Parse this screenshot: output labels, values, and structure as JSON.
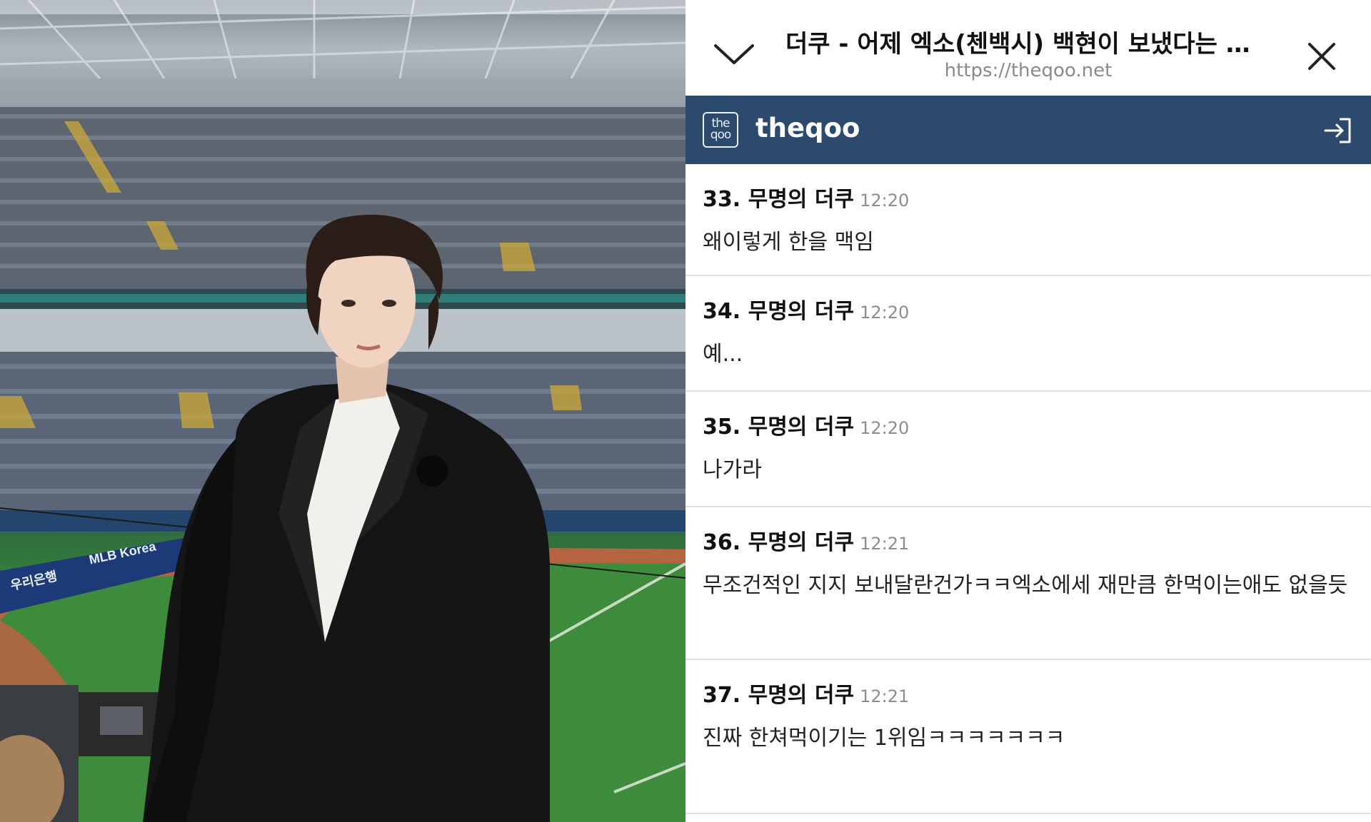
{
  "browser": {
    "title": "더쿠 - 어제 엑소(첸백시) 백현이 보냈다는 버…",
    "url": "https://theqoo.net",
    "icons": {
      "collapse": "chevron-down-icon",
      "close": "close-icon"
    }
  },
  "site": {
    "logo_text": "the qoo",
    "name": "theqoo",
    "bar_color": "#2c4a6e",
    "login_icon": "login-icon"
  },
  "comments": [
    {
      "number": "33.",
      "author": "무명의 더쿠",
      "time": "12:20",
      "text": "왜이렇게 한을 맥임"
    },
    {
      "number": "34.",
      "author": "무명의 더쿠",
      "time": "12:20",
      "text": "예..."
    },
    {
      "number": "35.",
      "author": "무명의 더쿠",
      "time": "12:20",
      "text": "나가라"
    },
    {
      "number": "36.",
      "author": "무명의 더쿠",
      "time": "12:21",
      "text": "무조건적인 지지 보내달란건가ㅋㅋ엑소에세 재만큼 한먹이는애도 없을듯"
    },
    {
      "number": "37.",
      "author": "무명의 더쿠",
      "time": "12:21",
      "text": "진짜 한쳐먹이기는 1위임ㅋㅋㅋㅋㅋㅋㅋ"
    }
  ],
  "photo": {
    "banner_text": "MLB Korea",
    "sponsor_text": "우리은행"
  }
}
